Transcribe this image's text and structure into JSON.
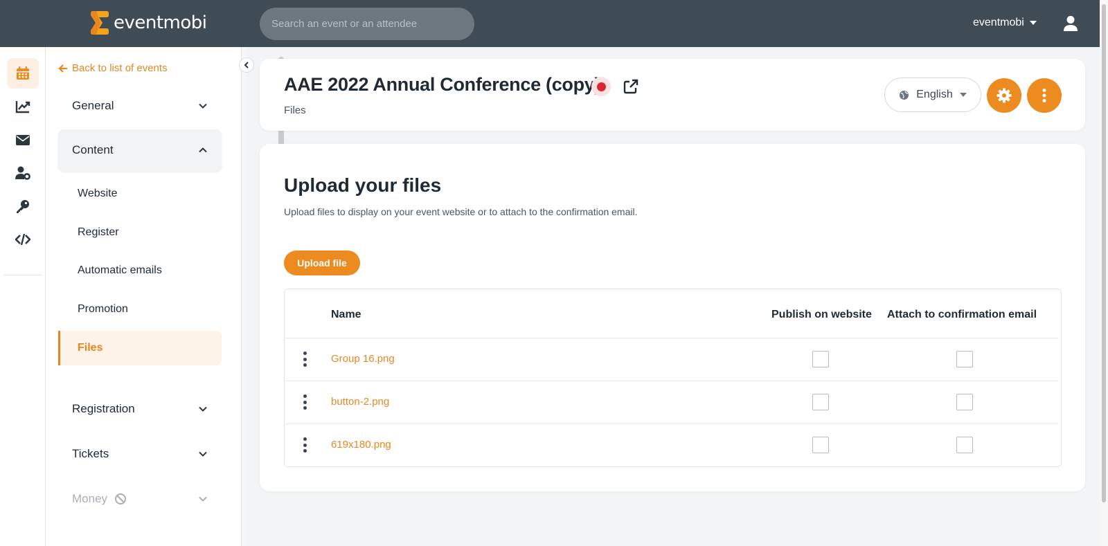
{
  "topbar": {
    "logo_text": "eventmobi",
    "search_placeholder": "Search an event or an attendee",
    "account_label": "eventmobi"
  },
  "rail": {
    "items": [
      "calendar-icon",
      "chart-line-icon",
      "envelope-icon",
      "user-gear-icon",
      "key-icon",
      "code-icon"
    ]
  },
  "subnav": {
    "back_label": "Back to list of events",
    "groups": {
      "general": "General",
      "content": "Content",
      "registration": "Registration",
      "tickets": "Tickets",
      "money": "Money"
    },
    "content_items": [
      "Website",
      "Register",
      "Automatic emails",
      "Promotion",
      "Files"
    ]
  },
  "header": {
    "event_title": "AAE 2022 Annual Conference (copy)",
    "breadcrumb": "Files",
    "language": "English"
  },
  "files_section": {
    "title": "Upload your files",
    "description": "Upload files to display on your event website or to attach to the confirmation email.",
    "upload_label": "Upload file",
    "columns": {
      "name": "Name",
      "publish": "Publish on website",
      "attach": "Attach to confirmation email"
    },
    "rows": [
      {
        "name": "Group 16.png",
        "publish": false,
        "attach": false
      },
      {
        "name": "button-2.png",
        "publish": false,
        "attach": false
      },
      {
        "name": "619x180.png",
        "publish": false,
        "attach": false
      }
    ]
  },
  "colors": {
    "accent": "#ec8b1f",
    "topbar": "#3f4b55",
    "live": "#d9262f"
  }
}
